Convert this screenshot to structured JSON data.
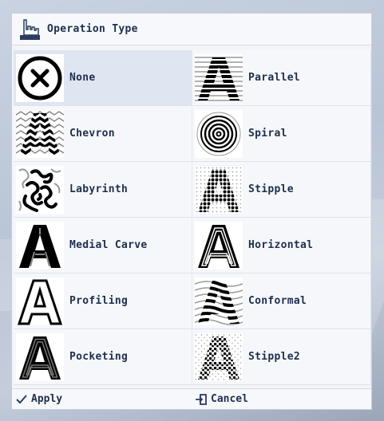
{
  "dialog": {
    "title": "Operation Type",
    "title_icon": "hand-pointer-icon"
  },
  "operations": [
    {
      "label": "None",
      "icon": "none-icon",
      "selected": true
    },
    {
      "label": "Parallel",
      "icon": "parallel-icon",
      "selected": false
    },
    {
      "label": "Chevron",
      "icon": "chevron-icon",
      "selected": false
    },
    {
      "label": "Spiral",
      "icon": "spiral-icon",
      "selected": false
    },
    {
      "label": "Labyrinth",
      "icon": "labyrinth-icon",
      "selected": false
    },
    {
      "label": "Stipple",
      "icon": "stipple-icon",
      "selected": false
    },
    {
      "label": "Medial Carve",
      "icon": "medial-carve-icon",
      "selected": false
    },
    {
      "label": "Horizontal",
      "icon": "horizontal-icon",
      "selected": false
    },
    {
      "label": "Profiling",
      "icon": "profiling-icon",
      "selected": false
    },
    {
      "label": "Conformal",
      "icon": "conformal-icon",
      "selected": false
    },
    {
      "label": "Pocketing",
      "icon": "pocketing-icon",
      "selected": false
    },
    {
      "label": "Stipple2",
      "icon": "stipple2-icon",
      "selected": false
    }
  ],
  "footer": {
    "apply_label": "Apply",
    "apply_icon": "checkmark-icon",
    "cancel_label": "Cancel",
    "cancel_icon": "exit-icon"
  },
  "colors": {
    "text": "#1f2f4d",
    "selected_bg": "#dfe5f1",
    "panel_bg": "#f3f5f9"
  }
}
